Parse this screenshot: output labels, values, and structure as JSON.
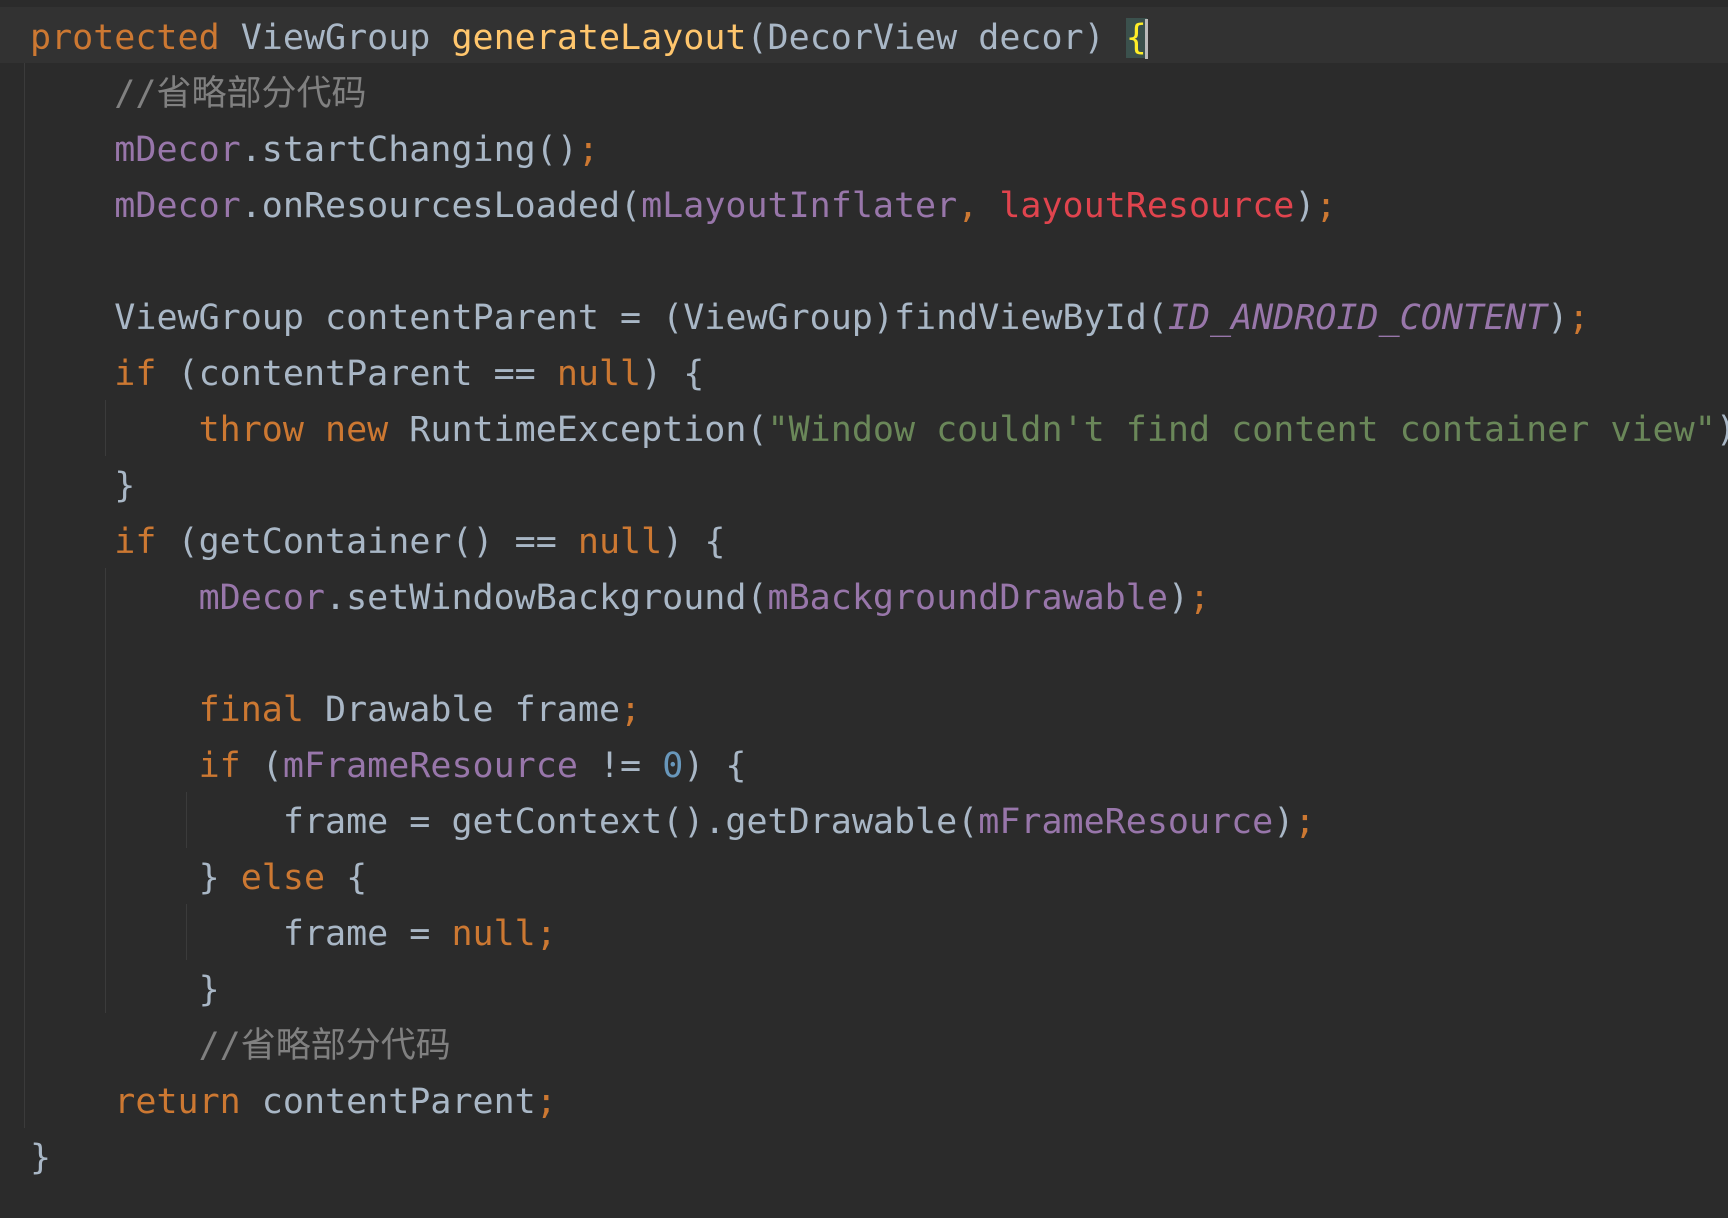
{
  "editor": {
    "lines": [
      {
        "tokens": [
          {
            "t": "protected",
            "c": "kw"
          },
          {
            "t": " ",
            "c": "plain"
          },
          {
            "t": "ViewGroup",
            "c": "plain"
          },
          {
            "t": " ",
            "c": "plain"
          },
          {
            "t": "generateLayout",
            "c": "fn"
          },
          {
            "t": "(DecorView decor) ",
            "c": "plain"
          },
          {
            "t": "{",
            "c": "brace-match"
          },
          {
            "t": "",
            "c": "caret"
          }
        ]
      },
      {
        "indent": 2,
        "tokens": [
          {
            "t": "//省略部分代码",
            "c": "cmt"
          }
        ]
      },
      {
        "indent": 2,
        "tokens": [
          {
            "t": "mDecor",
            "c": "fld"
          },
          {
            "t": ".startChanging()",
            "c": "plain"
          },
          {
            "t": ";",
            "c": "semi"
          }
        ]
      },
      {
        "indent": 2,
        "tokens": [
          {
            "t": "mDecor",
            "c": "fld"
          },
          {
            "t": ".onResourcesLoaded(",
            "c": "plain"
          },
          {
            "t": "mLayoutInflater",
            "c": "fld"
          },
          {
            "t": ", ",
            "c": "semi"
          },
          {
            "t": "layoutResource",
            "c": "red"
          },
          {
            "t": ")",
            "c": "plain"
          },
          {
            "t": ";",
            "c": "semi"
          }
        ]
      },
      {
        "tokens": []
      },
      {
        "indent": 2,
        "tokens": [
          {
            "t": "ViewGroup contentParent = (ViewGroup)findViewById(",
            "c": "plain"
          },
          {
            "t": "ID_ANDROID_CONTENT",
            "c": "cst"
          },
          {
            "t": ")",
            "c": "plain"
          },
          {
            "t": ";",
            "c": "semi"
          }
        ]
      },
      {
        "indent": 2,
        "tokens": [
          {
            "t": "if",
            "c": "kw"
          },
          {
            "t": " (contentParent == ",
            "c": "plain"
          },
          {
            "t": "null",
            "c": "kw"
          },
          {
            "t": ") {",
            "c": "plain"
          }
        ]
      },
      {
        "indent": 4,
        "tokens": [
          {
            "t": "throw",
            "c": "kw"
          },
          {
            "t": " ",
            "c": "plain"
          },
          {
            "t": "new",
            "c": "kw"
          },
          {
            "t": " RuntimeException(",
            "c": "plain"
          },
          {
            "t": "\"Window couldn't find content container view\"",
            "c": "str"
          },
          {
            "t": ")",
            "c": "plain"
          },
          {
            "t": ";",
            "c": "semi"
          }
        ]
      },
      {
        "indent": 2,
        "tokens": [
          {
            "t": "}",
            "c": "plain"
          }
        ]
      },
      {
        "indent": 2,
        "tokens": [
          {
            "t": "if",
            "c": "kw"
          },
          {
            "t": " (getContainer() == ",
            "c": "plain"
          },
          {
            "t": "null",
            "c": "kw"
          },
          {
            "t": ") {",
            "c": "plain"
          }
        ]
      },
      {
        "indent": 4,
        "tokens": [
          {
            "t": "mDecor",
            "c": "fld"
          },
          {
            "t": ".setWindowBackground(",
            "c": "plain"
          },
          {
            "t": "mBackgroundDrawable",
            "c": "fld"
          },
          {
            "t": ")",
            "c": "plain"
          },
          {
            "t": ";",
            "c": "semi"
          }
        ]
      },
      {
        "tokens": []
      },
      {
        "indent": 4,
        "tokens": [
          {
            "t": "final",
            "c": "kw"
          },
          {
            "t": " Drawable frame",
            "c": "plain"
          },
          {
            "t": ";",
            "c": "semi"
          }
        ]
      },
      {
        "indent": 4,
        "tokens": [
          {
            "t": "if",
            "c": "kw"
          },
          {
            "t": " (",
            "c": "plain"
          },
          {
            "t": "mFrameResource",
            "c": "fld"
          },
          {
            "t": " != ",
            "c": "plain"
          },
          {
            "t": "0",
            "c": "num"
          },
          {
            "t": ") {",
            "c": "plain"
          }
        ]
      },
      {
        "indent": 6,
        "tokens": [
          {
            "t": "frame = getContext().getDrawable(",
            "c": "plain"
          },
          {
            "t": "mFrameResource",
            "c": "fld"
          },
          {
            "t": ")",
            "c": "plain"
          },
          {
            "t": ";",
            "c": "semi"
          }
        ]
      },
      {
        "indent": 4,
        "tokens": [
          {
            "t": "} ",
            "c": "plain"
          },
          {
            "t": "else",
            "c": "kw"
          },
          {
            "t": " {",
            "c": "plain"
          }
        ]
      },
      {
        "indent": 6,
        "tokens": [
          {
            "t": "frame = ",
            "c": "plain"
          },
          {
            "t": "null",
            "c": "kw"
          },
          {
            "t": ";",
            "c": "semi"
          }
        ]
      },
      {
        "indent": 4,
        "tokens": [
          {
            "t": "}",
            "c": "plain"
          }
        ]
      },
      {
        "indent": 4,
        "tokens": [
          {
            "t": "//省略部分代码",
            "c": "cmt"
          }
        ]
      },
      {
        "indent": 2,
        "tokens": [
          {
            "t": "return",
            "c": "kw"
          },
          {
            "t": " contentParent",
            "c": "plain"
          },
          {
            "t": ";",
            "c": "semi"
          }
        ]
      },
      {
        "tokens": [
          {
            "t": "}",
            "c": "plain"
          }
        ]
      }
    ]
  }
}
